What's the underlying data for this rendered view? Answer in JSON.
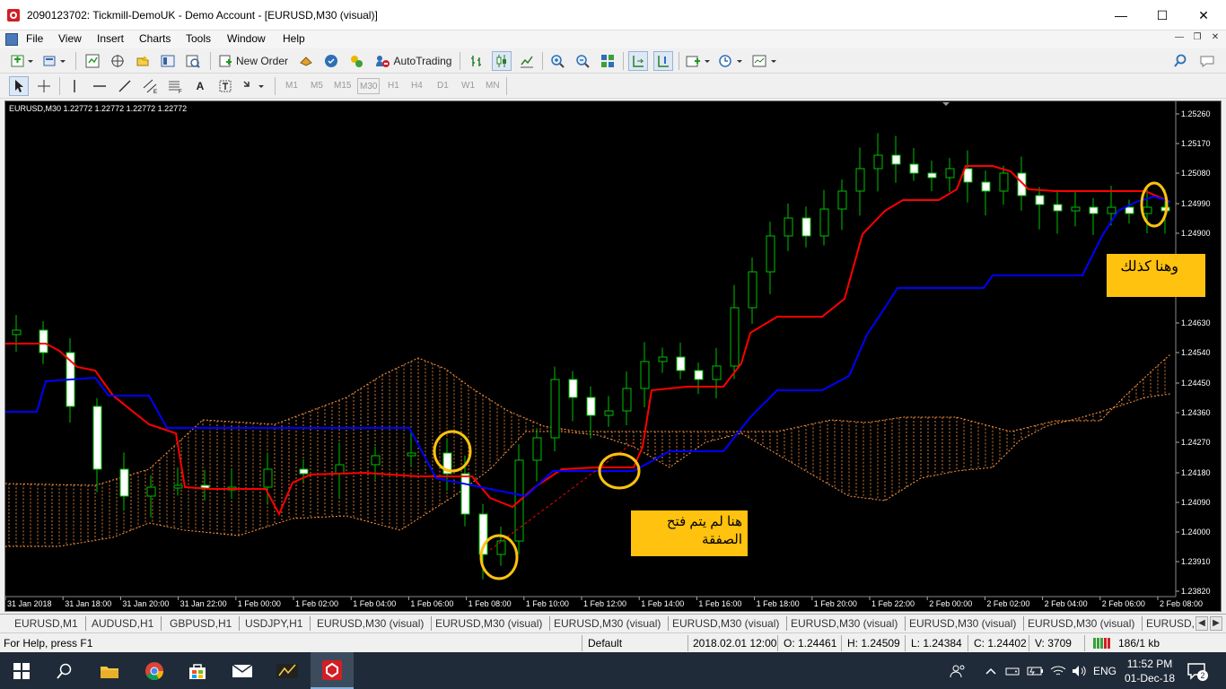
{
  "window": {
    "title": "2090123702: Tickmill-DemoUK - Demo Account - [EURUSD,M30 (visual)]"
  },
  "menu": [
    "File",
    "View",
    "Insert",
    "Charts",
    "Tools",
    "Window",
    "Help"
  ],
  "toolbar": {
    "new_order_label": "New Order",
    "autotrading_label": "AutoTrading",
    "timeframes": [
      "M1",
      "M5",
      "M15",
      "M30",
      "H1",
      "H4",
      "D1",
      "W1",
      "MN"
    ],
    "text_tool_label": "A"
  },
  "chart": {
    "header": "EURUSD,M30  1.22772 1.22772 1.22772 1.22772",
    "price_labels": [
      "1.25260",
      "1.25170",
      "1.25080",
      "1.24990",
      "1.24900",
      "10",
      "20",
      "1.24630",
      "1.24540",
      "1.24450",
      "1.24360",
      "1.24270",
      "1.24180",
      "1.24090",
      "1.24000",
      "1.23910",
      "1.23820"
    ],
    "time_labels": [
      "31 Jan 2018",
      "31 Jan 18:00",
      "31 Jan 20:00",
      "31 Jan 22:00",
      "1 Feb 00:00",
      "1 Feb 02:00",
      "1 Feb 04:00",
      "1 Feb 06:00",
      "1 Feb 08:00",
      "1 Feb 10:00",
      "1 Feb 12:00",
      "1 Feb 14:00",
      "1 Feb 16:00",
      "1 Feb 18:00",
      "1 Feb 20:00",
      "1 Feb 22:00",
      "2 Feb 00:00",
      "2 Feb 02:00",
      "2 Feb 04:00",
      "2 Feb 06:00",
      "2 Feb 08:00"
    ],
    "annotation_1": "هنا لم يتم فتح\nالصفقة",
    "annotation_2": "وهنا كذلك",
    "colors": {
      "background": "#000000",
      "tenkan": "#ff0000",
      "kijun": "#0000ff",
      "cloud": "#ff9640",
      "candle_up": "#000000",
      "candle_down": "#ffffff",
      "wick": "#00c000",
      "annotation_bg": "#ffc20e",
      "highlight_circle": "#ffc20e"
    }
  },
  "tabs": [
    "EURUSD,M1",
    "AUDUSD,H1",
    "GBPUSD,H1",
    "USDJPY,H1",
    "EURUSD,M30 (visual)",
    "EURUSD,M30 (visual)",
    "EURUSD,M30 (visual)",
    "EURUSD,M30 (visual)",
    "EURUSD,M30 (visual)",
    "EURUSD,M30 (visual)",
    "EURUSD,M30 (visual)",
    "EURUSD,"
  ],
  "status": {
    "help": "For Help, press F1",
    "profile": "Default",
    "datetime": "2018.02.01 12:00",
    "open": "O: 1.24461",
    "high": "H: 1.24509",
    "low": "L: 1.24384",
    "close": "C: 1.24402",
    "volume": "V: 3709",
    "traffic": "186/1 kb"
  },
  "taskbar": {
    "language": "ENG",
    "time": "11:52 PM",
    "date": "01-Dec-18",
    "notifications": "2"
  }
}
